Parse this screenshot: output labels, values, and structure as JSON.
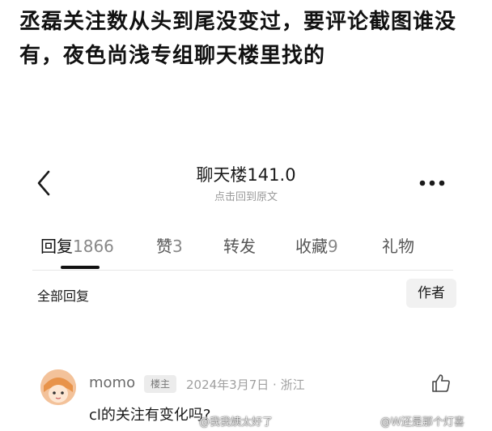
{
  "caption": "丞磊关注数从头到尾没变过，要评论截图谁没有，夜色尚浅专组聊天楼里找的",
  "header": {
    "title": "聊天楼141.0",
    "subtitle": "点击回到原文",
    "back_icon": "chevron-left-icon",
    "more_icon": "more-dots-icon"
  },
  "tabs": [
    {
      "label": "回复",
      "count": "1866"
    },
    {
      "label": "赞",
      "count": "3"
    },
    {
      "label": "转发",
      "count": ""
    },
    {
      "label": "收藏",
      "count": "9"
    },
    {
      "label": "礼物",
      "count": ""
    }
  ],
  "filter": {
    "label": "全部回复",
    "author_button": "作者"
  },
  "post": {
    "username": "momo",
    "badge": "楼主",
    "meta": "2024年3月7日 · 浙江",
    "content": "cl的关注有变化吗?",
    "like_icon": "thumbs-up-icon"
  },
  "watermarks": {
    "left": "@我我姨太好了",
    "right": "@W还是那个灯喜"
  }
}
